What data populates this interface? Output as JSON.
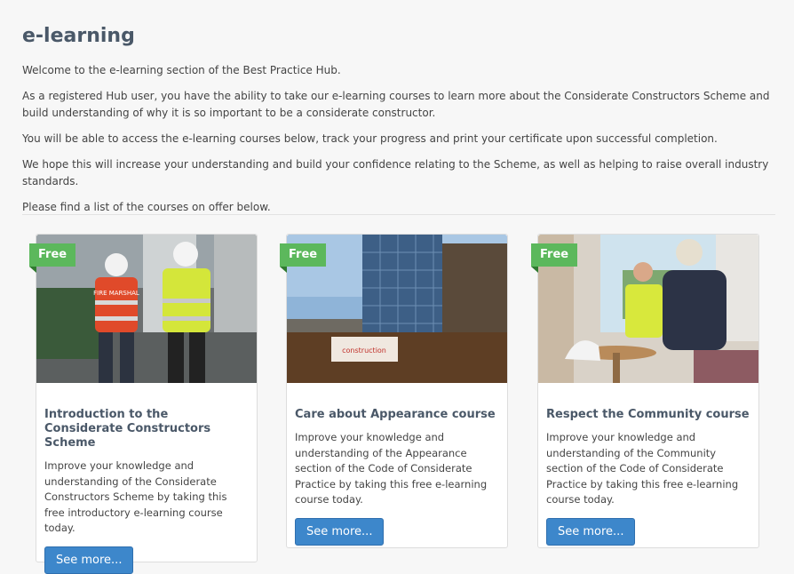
{
  "page": {
    "title": "e-learning",
    "intro": [
      "Welcome to the e-learning section of the Best Practice Hub.",
      "As a registered Hub user, you have the ability to take our e-learning courses to learn more about the Considerate Constructors Scheme and build understanding of why it is so important to be a considerate constructor.",
      "You will be able to access the e-learning courses below, track your progress and print your certificate upon successful completion.",
      "We hope this will increase your understanding and build your confidence relating to the Scheme, as well as helping to raise overall industry standards.",
      "Please find a list of the courses on offer below."
    ]
  },
  "courses": [
    {
      "badge": "Free",
      "title": "Introduction to the Considerate Constructors Scheme",
      "description": "Improve your knowledge and understanding of the Considerate Constructors Scheme by taking this free introductory e-learning course today.",
      "button": "See more..."
    },
    {
      "badge": "Free",
      "title": "Care about Appearance course",
      "description": "Improve your knowledge and understanding of the Appearance section of the Code of Considerate Practice by taking this free e-learning course today.",
      "button": "See more..."
    },
    {
      "badge": "Free",
      "title": "Respect the Community course",
      "description": "Improve your knowledge and understanding of the Community section of the Code of Considerate Practice by taking this free e-learning course today.",
      "button": "See more..."
    }
  ],
  "images": {
    "card1_sign_text": "FIRE MARSHAL",
    "card2_banner_text": "construction"
  },
  "colors": {
    "badge": "#5cb85c",
    "button": "#3d87cb",
    "title": "#4a5868"
  }
}
